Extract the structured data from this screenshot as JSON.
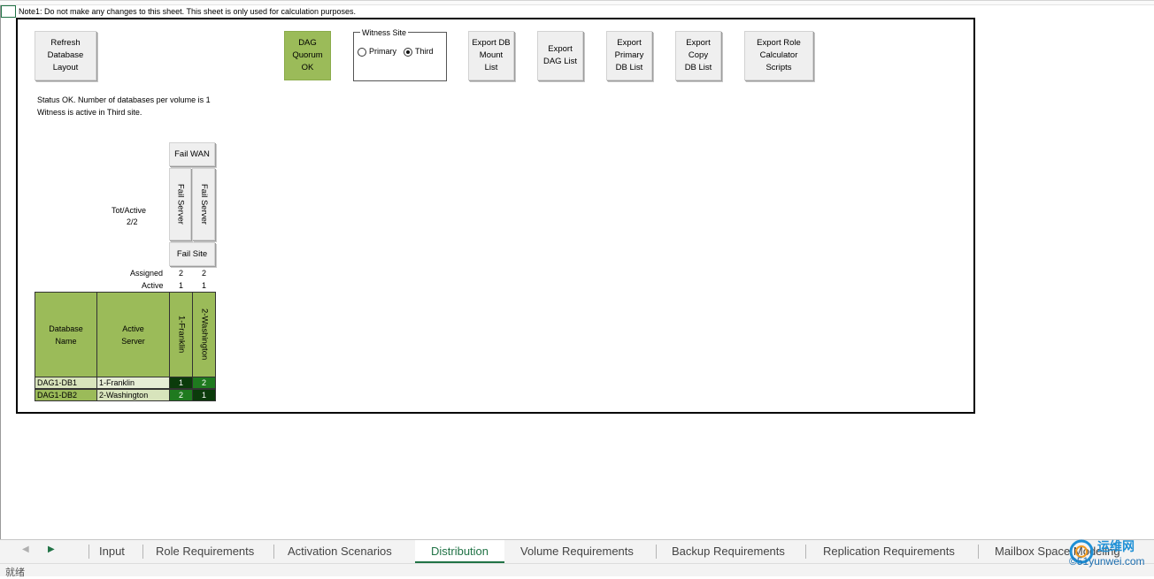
{
  "note": "Note1: Do not make any changes to this sheet.  This sheet is only used for calculation purposes.",
  "buttons": {
    "refresh": "Refresh\nDatabase\nLayout",
    "quorum": "DAG\nQuorum\nOK",
    "export_db_mount": "Export DB\nMount\nList",
    "export_dag": "Export\nDAG List",
    "export_primary": "Export\nPrimary\nDB List",
    "export_copy": "Export\nCopy\nDB List",
    "export_role": "Export Role\nCalculator\nScripts",
    "fail_wan": "Fail WAN",
    "fail_server_1": "Fail Server",
    "fail_server_2": "Fail Server",
    "fail_site": "Fail Site"
  },
  "witness": {
    "legend": "Witness Site",
    "options": [
      "Primary",
      "Third"
    ],
    "selected": "Third"
  },
  "status": {
    "line1": "Status OK.  Number of databases per volume is 1",
    "line2": "Witness is active in Third site."
  },
  "tot_active": {
    "label": "Tot/Active",
    "value": "2/2"
  },
  "assigned": {
    "label": "Assigned",
    "values": [
      "2",
      "2"
    ]
  },
  "active": {
    "label": "Active",
    "values": [
      "1",
      "1"
    ]
  },
  "table": {
    "headers": [
      "Database\nName",
      "Active\nServer"
    ],
    "servers": [
      "1-Franklin",
      "2-Washington"
    ],
    "rows": [
      {
        "db": "DAG1-DB1",
        "server": "1-Franklin",
        "cells": [
          "1",
          "2"
        ]
      },
      {
        "db": "DAG1-DB2",
        "server": "2-Washington",
        "cells": [
          "2",
          "1"
        ]
      }
    ]
  },
  "colors": {
    "header_green": "#9bbb59",
    "light_green": "#d8e4bc",
    "dark_green": "#0b3b0b",
    "mid_green": "#1f7a1f",
    "excel_green": "#217346"
  },
  "tabs": [
    "Input",
    "Role Requirements",
    "Activation Scenarios",
    "Distribution",
    "Volume Requirements",
    "Backup Requirements",
    "Replication Requirements",
    "Mailbox Space Modeling"
  ],
  "active_tab": "Distribution",
  "status_bar": "就绪",
  "watermark": {
    "line1": "运维网",
    "line2": "©51yunwei.com"
  }
}
